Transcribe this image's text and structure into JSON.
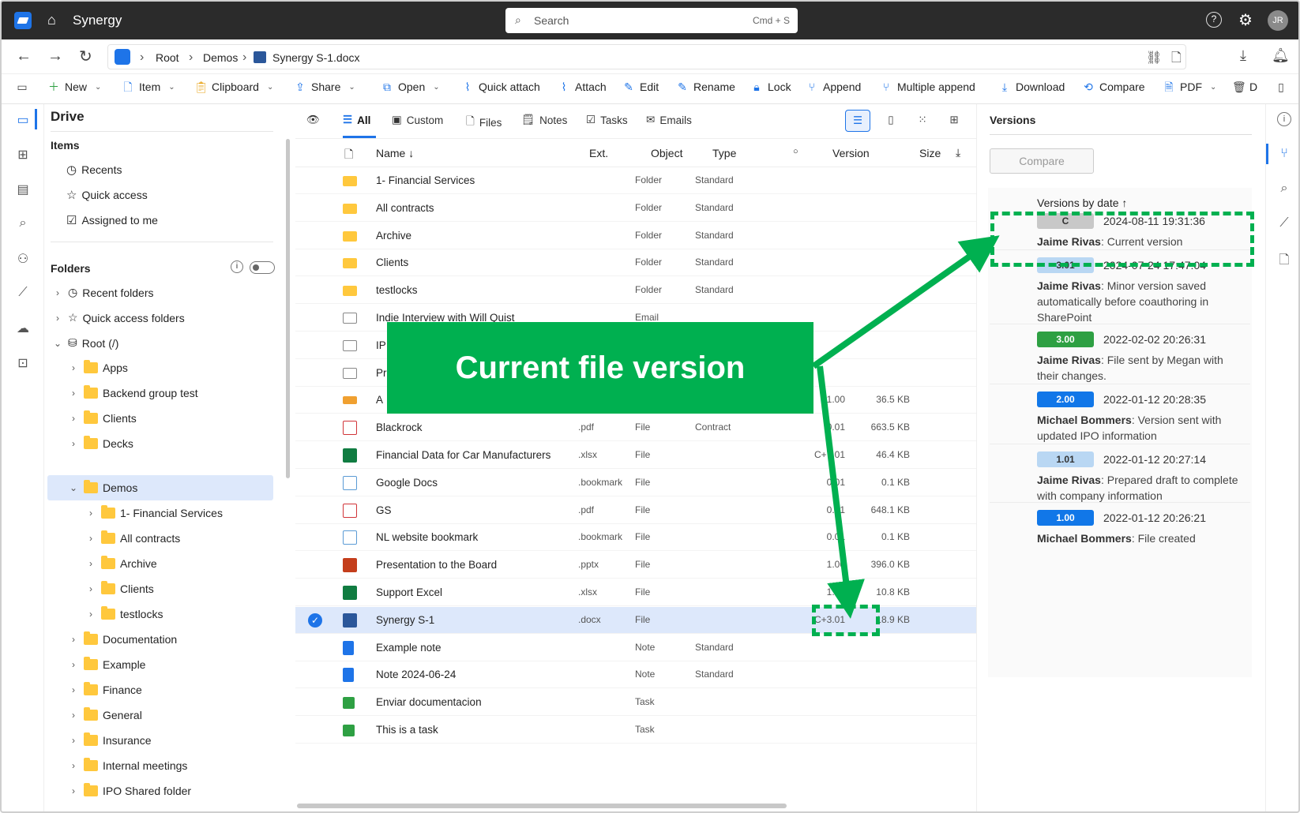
{
  "app": {
    "title": "Synergy",
    "search_placeholder": "Search",
    "search_shortcut": "Cmd + S",
    "avatar": "JR"
  },
  "breadcrumb": {
    "items": [
      "Root",
      "Demos"
    ],
    "current": "Synergy S-1.docx"
  },
  "toolbar": {
    "items": [
      "New",
      "Item",
      "Clipboard",
      "Share",
      "Open",
      "Quick attach",
      "Attach",
      "Edit",
      "Rename",
      "Lock",
      "Append",
      "Multiple append",
      "Download",
      "Compare",
      "PDF",
      "D"
    ]
  },
  "sidebar": {
    "title": "Drive",
    "items_heading": "Items",
    "items": [
      "Recents",
      "Quick access",
      "Assigned to me"
    ],
    "folders_heading": "Folders",
    "tree": [
      "Recent folders",
      "Quick access folders",
      "Root (/)",
      "Apps",
      "Backend group test",
      "Clients",
      "Decks",
      "Demos",
      "1- Financial Services",
      "All contracts",
      "Archive",
      "Clients",
      "testlocks",
      "Documentation",
      "Example",
      "Finance",
      "General",
      "Insurance",
      "Internal meetings",
      "IPO Shared folder"
    ]
  },
  "tabs": [
    "All",
    "Custom",
    "Files",
    "Notes",
    "Tasks",
    "Emails"
  ],
  "columns": {
    "name": "Name ↓",
    "ext": "Ext.",
    "object": "Object",
    "type": "Type",
    "version": "Version",
    "size": "Size"
  },
  "rows": [
    {
      "name": "1- Financial Services",
      "ext": "",
      "object": "Folder",
      "type": "Standard",
      "version": "",
      "size": ""
    },
    {
      "name": "All contracts",
      "ext": "",
      "object": "Folder",
      "type": "Standard",
      "version": "",
      "size": ""
    },
    {
      "name": "Archive",
      "ext": "",
      "object": "Folder",
      "type": "Standard",
      "version": "",
      "size": ""
    },
    {
      "name": "Clients",
      "ext": "",
      "object": "Folder",
      "type": "Standard",
      "version": "",
      "size": ""
    },
    {
      "name": "testlocks",
      "ext": "",
      "object": "Folder",
      "type": "Standard",
      "version": "",
      "size": ""
    },
    {
      "name": "Indie Interview with Will Quist",
      "ext": "",
      "object": "Email",
      "type": "",
      "version": "",
      "size": ""
    },
    {
      "name": "IP",
      "ext": "",
      "object": "",
      "type": "",
      "version": "",
      "size": ""
    },
    {
      "name": "Pr",
      "ext": "",
      "object": "",
      "type": "",
      "version": "",
      "size": ""
    },
    {
      "name": "A",
      "ext": "",
      "object": "",
      "type": "",
      "version": "1.00",
      "size": "36.5 KB"
    },
    {
      "name": "Blackrock",
      "ext": ".pdf",
      "object": "File",
      "type": "Contract",
      "version": "0.01",
      "size": "663.5 KB"
    },
    {
      "name": "Financial Data for Car Manufacturers",
      "ext": ".xlsx",
      "object": "File",
      "type": "",
      "version": "C+7.01",
      "size": "46.4 KB"
    },
    {
      "name": "Google Docs",
      "ext": ".bookmark",
      "object": "File",
      "type": "",
      "version": "0.01",
      "size": "0.1 KB"
    },
    {
      "name": "GS",
      "ext": ".pdf",
      "object": "File",
      "type": "",
      "version": "0.01",
      "size": "648.1 KB"
    },
    {
      "name": "NL website bookmark",
      "ext": ".bookmark",
      "object": "File",
      "type": "",
      "version": "0.01",
      "size": "0.1 KB"
    },
    {
      "name": "Presentation to the Board",
      "ext": ".pptx",
      "object": "File",
      "type": "",
      "version": "1.00",
      "size": "396.0 KB"
    },
    {
      "name": "Support Excel",
      "ext": ".xlsx",
      "object": "File",
      "type": "",
      "version": "1.00",
      "size": "10.8 KB"
    },
    {
      "name": "Synergy S-1",
      "ext": ".docx",
      "object": "File",
      "type": "",
      "version": "C+3.01",
      "size": "18.9 KB"
    },
    {
      "name": "Example note",
      "ext": "",
      "object": "Note",
      "type": "Standard",
      "version": "",
      "size": ""
    },
    {
      "name": "Note 2024-06-24",
      "ext": "",
      "object": "Note",
      "type": "Standard",
      "version": "",
      "size": ""
    },
    {
      "name": "Enviar documentacion",
      "ext": "",
      "object": "Task",
      "type": "",
      "version": "",
      "size": ""
    },
    {
      "name": "This is a task",
      "ext": "",
      "object": "Task",
      "type": "",
      "version": "",
      "size": ""
    }
  ],
  "versions": {
    "title": "Versions",
    "compare_label": "Compare",
    "sort_label": "Versions by date ↑",
    "list": [
      {
        "badge": "C",
        "date": "2024-08-11 19:31:36",
        "user": "Jaime Rivas",
        "note": ": Current version",
        "color": "#c8c8c8",
        "text_color": "#333"
      },
      {
        "badge": "3.01",
        "date": "2024-07-24 17:47:04",
        "user": "Jaime Rivas",
        "note": ": Minor version saved automatically before coauthoring in SharePoint",
        "color": "#b9d7f3",
        "text_color": "#333"
      },
      {
        "badge": "3.00",
        "date": "2022-02-02 20:26:31",
        "user": "Jaime Rivas",
        "note": ": File sent by Megan with their changes.",
        "color": "#2ea043",
        "text_color": "#fff"
      },
      {
        "badge": "2.00",
        "date": "2022-01-12 20:28:35",
        "user": "Michael Bommers",
        "note": ": Version sent with updated IPO information",
        "color": "#1177e8",
        "text_color": "#fff"
      },
      {
        "badge": "1.01",
        "date": "2022-01-12 20:27:14",
        "user": "Jaime Rivas",
        "note": ": Prepared draft to complete with company information",
        "color": "#b9d7f3",
        "text_color": "#333"
      },
      {
        "badge": "1.00",
        "date": "2022-01-12 20:26:21",
        "user": "Michael Bommers",
        "note": ": File created",
        "color": "#1177e8",
        "text_color": "#fff"
      }
    ]
  },
  "callout": {
    "text": "Current file version"
  }
}
